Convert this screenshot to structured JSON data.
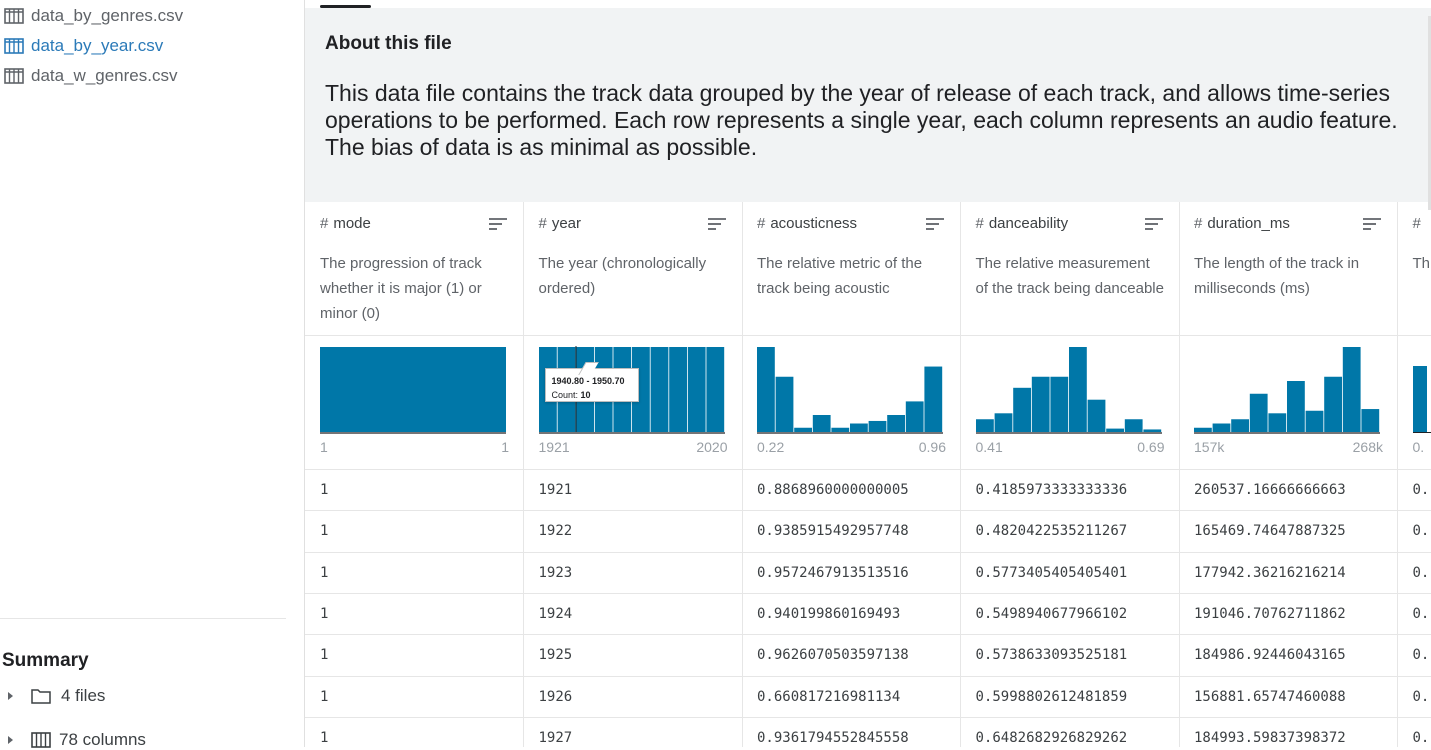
{
  "sidebar": {
    "files": [
      {
        "name": "data_by_genres.csv",
        "active": false
      },
      {
        "name": "data_by_year.csv",
        "active": true
      },
      {
        "name": "data_w_genres.csv",
        "active": false
      }
    ],
    "summary": {
      "title": "Summary",
      "files_label": "4 files",
      "columns_label": "78 columns"
    }
  },
  "about": {
    "title": "About this file",
    "description": "This data file contains the track data grouped by the year of release of each track, and allows time-series operations to be performed. Each row represents a single year, each column represents an audio feature. The bias of data is as minimal as possible."
  },
  "columns": [
    {
      "name": "mode",
      "desc": "The progression of track whether it is major (1) or minor (0)",
      "min": "1",
      "max": "1",
      "hist": [
        1
      ]
    },
    {
      "name": "year",
      "desc": "The year (chronologically ordered)",
      "min": "1921",
      "max": "2020",
      "hist": [
        1,
        1,
        1,
        1,
        1,
        1,
        1,
        1,
        1,
        1
      ],
      "tooltip": {
        "range": "1940.80 - 1950.70",
        "count_label": "Count:",
        "count": "10"
      }
    },
    {
      "name": "acousticness",
      "desc": "The relative metric of the track being acoustic",
      "min": "0.22",
      "max": "0.96",
      "hist": [
        1.0,
        0.65,
        0.05,
        0.2,
        0.05,
        0.1,
        0.13,
        0.2,
        0.36,
        0.77
      ]
    },
    {
      "name": "danceability",
      "desc": "The relative measurement of the track being danceable",
      "min": "0.41",
      "max": "0.69",
      "hist": [
        0.15,
        0.22,
        0.52,
        0.65,
        0.65,
        1.0,
        0.38,
        0.04,
        0.15,
        0.03
      ]
    },
    {
      "name": "duration_ms",
      "desc": "The length of the track in milliseconds (ms)",
      "min": "157k",
      "max": "268k",
      "hist": [
        0.05,
        0.1,
        0.15,
        0.45,
        0.22,
        0.6,
        0.25,
        0.65,
        1.0,
        0.27
      ]
    }
  ],
  "partial_column": {
    "head": "#",
    "desc": "Th",
    "min": "0."
  },
  "rows": [
    [
      "1",
      "1921",
      "0.8868960000000005",
      "0.4185973333333336",
      "260537.16666666663",
      "0."
    ],
    [
      "1",
      "1922",
      "0.9385915492957748",
      "0.4820422535211267",
      "165469.74647887325",
      "0."
    ],
    [
      "1",
      "1923",
      "0.9572467913513516",
      "0.5773405405405401",
      "177942.36216216214",
      "0."
    ],
    [
      "1",
      "1924",
      "0.940199860169493",
      "0.5498940677966102",
      "191046.70762711862",
      "0."
    ],
    [
      "1",
      "1925",
      "0.9626070503597138",
      "0.5738633093525181",
      "184986.92446043165",
      "0."
    ],
    [
      "1",
      "1926",
      "0.660817216981134",
      "0.5998802612481859",
      "156881.65747460088",
      "0."
    ],
    [
      "1",
      "1927",
      "0.9361794552845558",
      "0.6482682926829262",
      "184993.59837398372",
      "0."
    ]
  ],
  "colors": {
    "bar": "#0077a8",
    "accent": "#2b7ab8"
  }
}
